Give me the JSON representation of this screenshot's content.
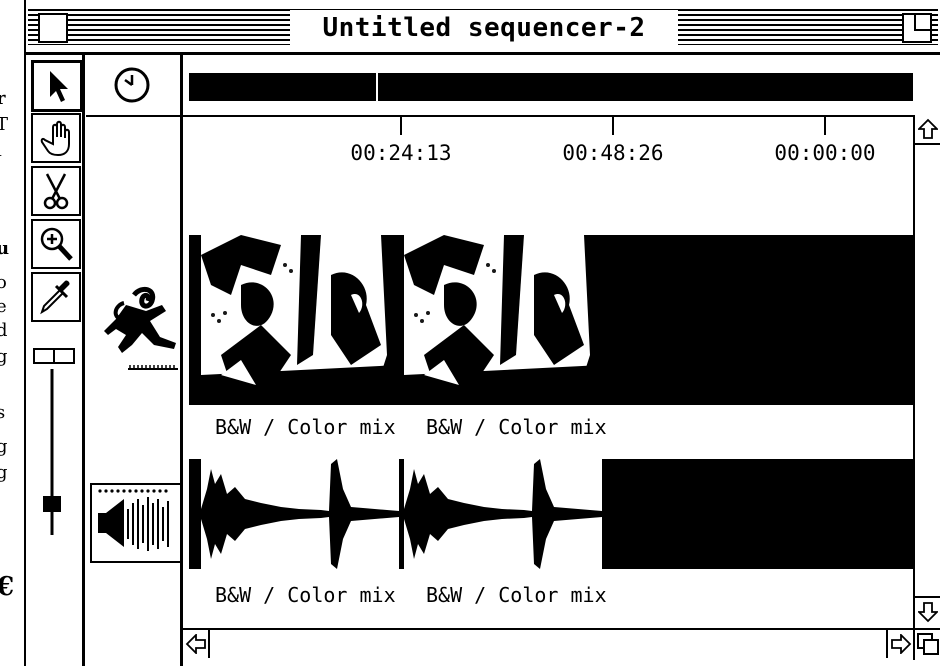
{
  "window": {
    "title": "Untitled sequencer-2"
  },
  "background_window": {
    "chars": [
      "r",
      "T",
      "ı",
      "u",
      "o",
      "e",
      "d",
      "g",
      "s",
      "g",
      "g",
      "€"
    ]
  },
  "toolbar": {
    "tools": [
      {
        "name": "arrow",
        "icon": "arrow-pointer-icon"
      },
      {
        "name": "hand",
        "icon": "hand-icon"
      },
      {
        "name": "scissors",
        "icon": "scissors-icon"
      },
      {
        "name": "zoom",
        "icon": "magnifier-icon"
      },
      {
        "name": "eyedropper",
        "icon": "eyedropper-icon"
      }
    ],
    "slider_level": 0.15
  },
  "timeline": {
    "timecodes": [
      "00:24:13",
      "00:48:26",
      "00:00:00"
    ],
    "playhead_fraction": 0.25
  },
  "tracks": [
    {
      "type": "video",
      "icon": "running-figure-icon",
      "clips": [
        "B&W / Color mix",
        "B&W / Color mix"
      ]
    },
    {
      "type": "audio",
      "icon": "speaker-icon",
      "clips": [
        "B&W / Color mix",
        "B&W / Color mix"
      ]
    }
  ]
}
